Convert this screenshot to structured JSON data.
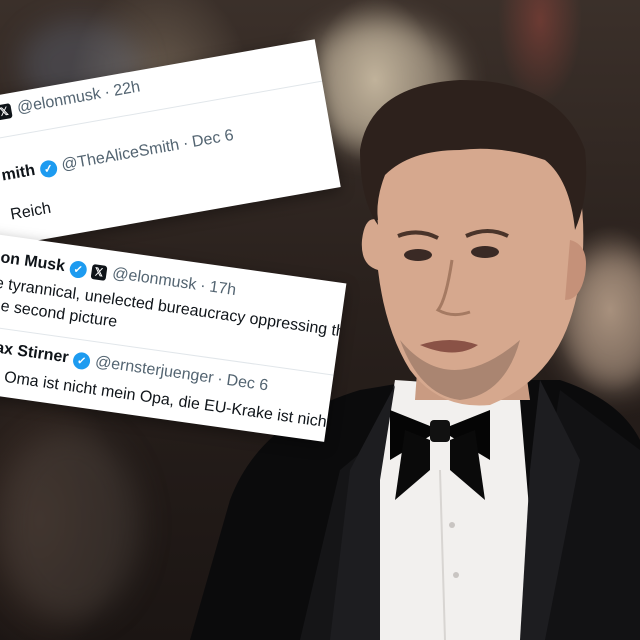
{
  "card_top": {
    "row1": {
      "handle": "@elonmusk",
      "time": "22h"
    },
    "row2": {
      "name": "mith",
      "handle": "@TheAliceSmith",
      "time": "Dec 6"
    },
    "row2_text": "Reich"
  },
  "card_bottom": {
    "tweet1": {
      "name": "on Musk",
      "handle": "@elonmusk",
      "time": "17h",
      "line1": "e tyrannical, unelected bureaucracy oppressing the peo",
      "line2": "he second picture"
    },
    "tweet2": {
      "name": "Max Stirner",
      "handle": "@ernsterjuenger",
      "time": "Dec 6",
      "line1": "ne Oma ist nicht mein Opa, die EU-Krake ist nicht Eu"
    }
  },
  "icons": {
    "verified": "verified-check-icon",
    "platform": "x-logo-icon"
  },
  "colors": {
    "verified": "#1d9bf0",
    "handle_gray": "#536471",
    "card_bg": "#ffffff"
  }
}
